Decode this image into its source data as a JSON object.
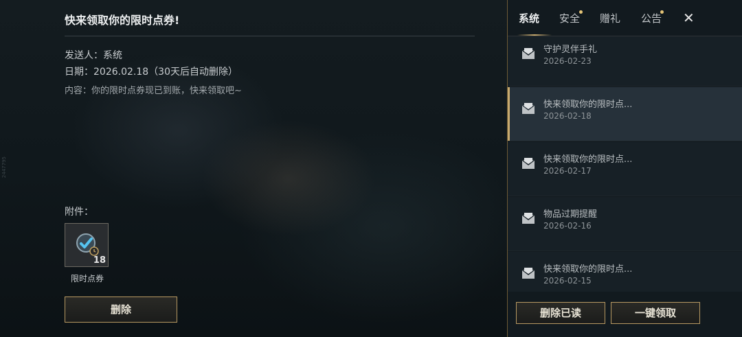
{
  "side_id": "2447795",
  "mail": {
    "title": "快来领取你的限时点券!",
    "sender": "发送人：系统",
    "date": "日期：2026.02.18（30天后自动删除）",
    "content": "内容：你的限时点券现已到账，快来领取吧~",
    "attachment_label": "附件：",
    "attachment": {
      "name": "限时点券",
      "count": "18",
      "icon": "ticket-icon"
    },
    "delete_label": "删除"
  },
  "tabs": [
    {
      "label": "系统",
      "active": true,
      "dot": false
    },
    {
      "label": "安全",
      "active": false,
      "dot": true
    },
    {
      "label": "赠礼",
      "active": false,
      "dot": false
    },
    {
      "label": "公告",
      "active": false,
      "dot": true
    }
  ],
  "close_icon": "close-icon",
  "mail_list": [
    {
      "title": "守护灵伴手礼",
      "date": "2026-02-23"
    },
    {
      "title": "快来领取你的限时点...",
      "date": "2026-02-18",
      "selected": true
    },
    {
      "title": "快来领取你的限时点...",
      "date": "2026-02-17"
    },
    {
      "title": "物品过期提醒",
      "date": "2026-02-16"
    },
    {
      "title": "快来领取你的限时点...",
      "date": "2026-02-15"
    }
  ],
  "buttons": {
    "delete_read": "删除已读",
    "claim_all": "一键领取"
  },
  "colors": {
    "accent_gold": "#c8aa6e",
    "panel_bg": "#121a1f"
  }
}
